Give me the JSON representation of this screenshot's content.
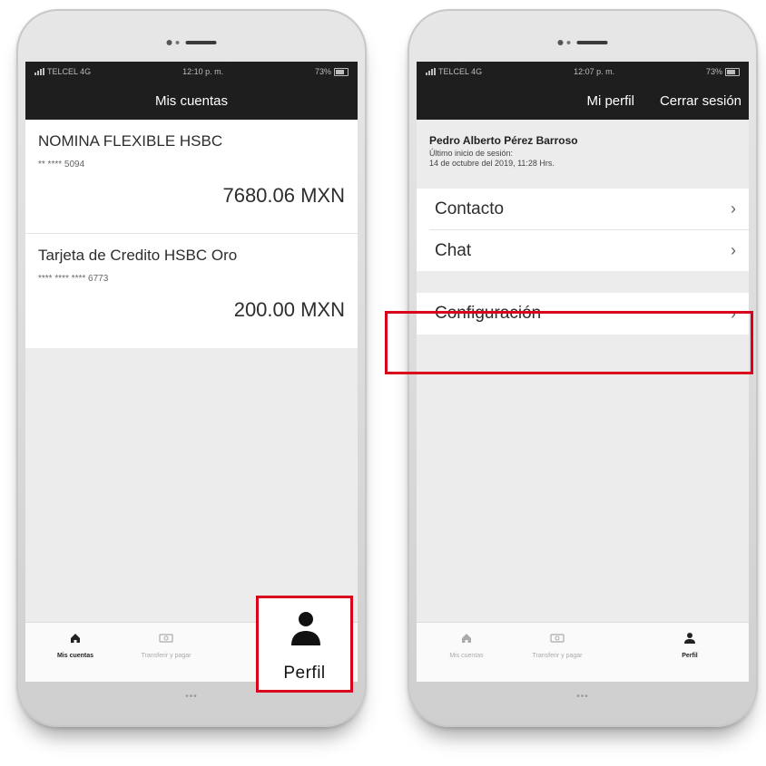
{
  "left_phone": {
    "status": {
      "carrier": "TELCEL 4G",
      "time": "12:10 p. m.",
      "battery": "73%"
    },
    "nav_title": "Mis cuentas",
    "accounts": [
      {
        "name": "NOMINA FLEXIBLE HSBC",
        "number": "** **** 5094",
        "balance": "7680.06 MXN"
      },
      {
        "name": "Tarjeta de Credito HSBC Oro",
        "number": "**** **** **** 6773",
        "balance": "200.00 MXN"
      }
    ],
    "tabs": [
      {
        "label": "Mis cuentas",
        "icon": "home-icon"
      },
      {
        "label": "Transferir y pagar",
        "icon": "transfer-icon"
      },
      {
        "label": "Perfil",
        "icon": "user-icon"
      }
    ],
    "home_indicator": "•••"
  },
  "right_phone": {
    "status": {
      "carrier": "TELCEL 4G",
      "time": "12:07 p. m.",
      "battery": "73%"
    },
    "nav_title": "Mi perfil",
    "nav_action": "Cerrar sesión",
    "user": {
      "name": "Pedro Alberto Pérez Barroso",
      "last_login_label": "Último inicio de sesión:",
      "last_login_value": "14 de octubre del 2019, 11:28 Hrs."
    },
    "menu": [
      {
        "label": "Contacto"
      },
      {
        "label": "Chat"
      },
      {
        "label": "Configuración"
      }
    ],
    "tabs": [
      {
        "label": "Mis cuentas",
        "icon": "home-icon"
      },
      {
        "label": "Transferir y pagar",
        "icon": "transfer-icon"
      },
      {
        "label": "Perfil",
        "icon": "user-icon"
      }
    ],
    "home_indicator": "•••"
  },
  "callout": {
    "perfil_label": "Perfil"
  },
  "colors": {
    "highlight": "#d9001b",
    "navbar": "#1e1e1e"
  }
}
